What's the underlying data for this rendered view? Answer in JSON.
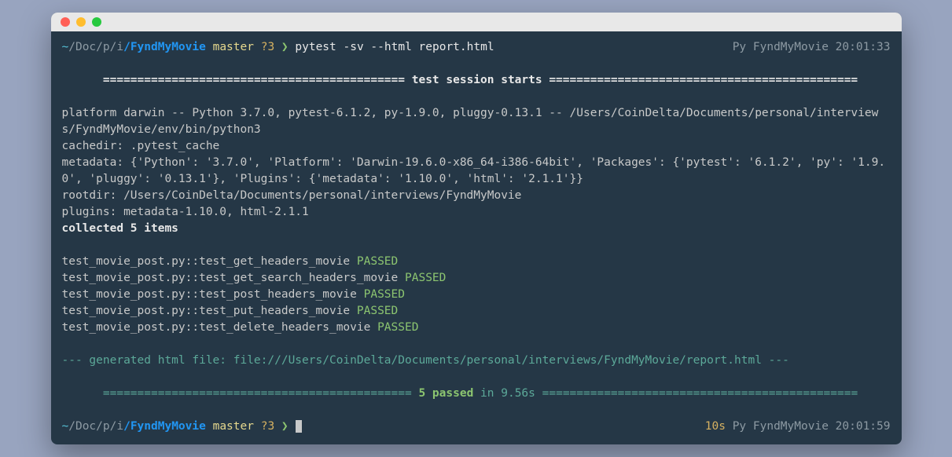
{
  "prompt1": {
    "tilde": "~",
    "path_a": "/Doc",
    "path_b": "/p",
    "path_c": "/i",
    "dir": "/FyndMyMovie",
    "branch": "master",
    "dirty": "?3",
    "arrow": "❯",
    "cmd": "pytest -sv --html report.html",
    "right_env": "Py",
    "right_proj": "FyndMyMovie",
    "right_time": "20:01:33"
  },
  "header": {
    "eq_left": "============================================",
    "title": " test session starts ",
    "eq_right": "============================================="
  },
  "platform_line": "platform darwin -- Python 3.7.0, pytest-6.1.2, py-1.9.0, pluggy-0.13.1 -- /Users/CoinDelta/Documents/personal/interviews/FyndMyMovie/env/bin/python3",
  "cachedir_line": "cachedir: .pytest_cache",
  "metadata_line": "metadata: {'Python': '3.7.0', 'Platform': 'Darwin-19.6.0-x86_64-i386-64bit', 'Packages': {'pytest': '6.1.2', 'py': '1.9.0', 'pluggy': '0.13.1'}, 'Plugins': {'metadata': '1.10.0', 'html': '2.1.1'}}",
  "rootdir_line": "rootdir: /Users/CoinDelta/Documents/personal/interviews/FyndMyMovie",
  "plugins_line": "plugins: metadata-1.10.0, html-2.1.1",
  "collected_line": "collected 5 items",
  "tests": [
    {
      "name": "test_movie_post.py::test_get_headers_movie ",
      "status": "PASSED"
    },
    {
      "name": "test_movie_post.py::test_get_search_headers_movie ",
      "status": "PASSED"
    },
    {
      "name": "test_movie_post.py::test_post_headers_movie ",
      "status": "PASSED"
    },
    {
      "name": "test_movie_post.py::test_put_headers_movie ",
      "status": "PASSED"
    },
    {
      "name": "test_movie_post.py::test_delete_headers_movie ",
      "status": "PASSED"
    }
  ],
  "generated_line": "--- generated html file: file:///Users/CoinDelta/Documents/personal/interviews/FyndMyMovie/report.html ---",
  "summary": {
    "eq_left": "=============================================",
    "passed": " 5 passed",
    "in_word": " in ",
    "time": "9.56s ",
    "eq_right": "=============================================="
  },
  "prompt2": {
    "tilde": "~",
    "path_a": "/Doc",
    "path_b": "/p",
    "path_c": "/i",
    "dir": "/FyndMyMovie",
    "branch": "master",
    "dirty": "?3",
    "arrow": "❯",
    "right_dur": "10s",
    "right_env": "Py",
    "right_proj": "FyndMyMovie",
    "right_time": "20:01:59"
  }
}
